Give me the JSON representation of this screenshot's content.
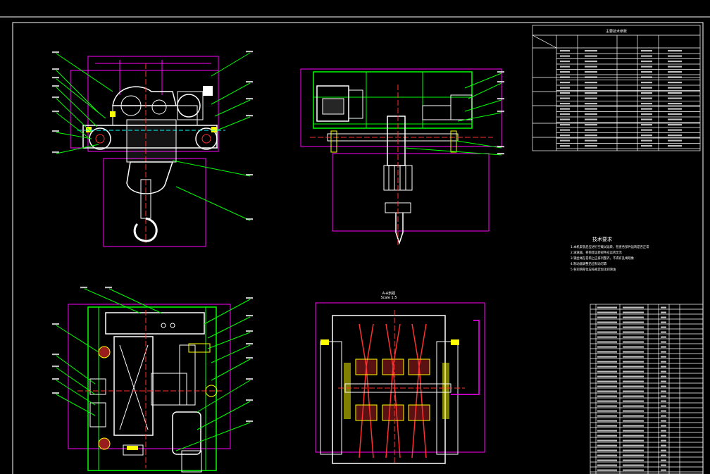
{
  "title_block": {
    "table_title": "主要技术参数"
  },
  "tech_requirements": {
    "title": "技术要求",
    "lines": [
      "1.本机安装后应进行空载试运转，检查各部件运转是否正常",
      "2.减速器、卷筒等运转部件应运转灵活",
      "3.钢丝绳在卷筒上应排列整齐，不得有乱绳现象",
      "4.制动器调整后应制动可靠",
      "5.各润滑部位应按规定加注润滑油"
    ]
  },
  "section_label": {
    "line1": "A-A剖视",
    "line2": "Scale 1:5"
  },
  "colors": {
    "frame": "#ffffff",
    "magenta": "#ff00ff",
    "green": "#00ff00",
    "yellow": "#ffff00",
    "red": "#ff3030",
    "cyan": "#00ffff",
    "gray": "#c0c0c0"
  }
}
